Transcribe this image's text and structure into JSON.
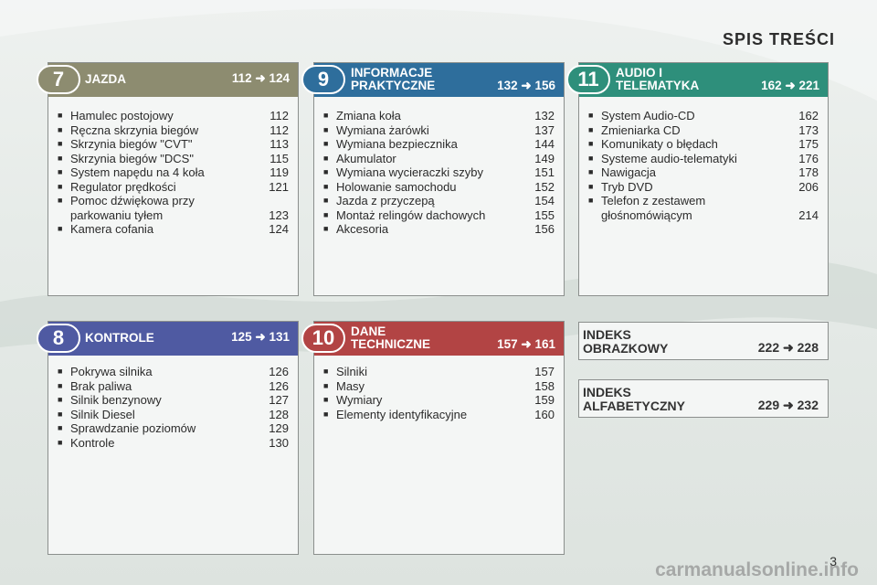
{
  "page_title": "SPIS TREŚCI",
  "colors": {
    "jazda": "#8d8c70",
    "kontrole": "#4f5aa2",
    "informacje": "#2e6e9c",
    "dane": "#b24444",
    "audio": "#2e8f7b"
  },
  "sections": {
    "jazda": {
      "number": "7",
      "title": "JAZDA",
      "pages": "112 ➜ 124",
      "items": [
        {
          "label": "Hamulec postojowy",
          "page": "112"
        },
        {
          "label": "Ręczna skrzynia biegów",
          "page": "112"
        },
        {
          "label": "Skrzynia biegów \"CVT\"",
          "page": "113"
        },
        {
          "label": "Skrzynia biegów \"DCS\"",
          "page": "115"
        },
        {
          "label": "System napędu na 4 koła",
          "page": "119"
        },
        {
          "label": "Regulator prędkości",
          "page": "121"
        },
        {
          "label": "Pomoc dźwiękowa przy parkowaniu tyłem",
          "page": "123"
        },
        {
          "label": "Kamera cofania",
          "page": "124"
        }
      ]
    },
    "kontrole": {
      "number": "8",
      "title": "KONTROLE",
      "pages": "125 ➜ 131",
      "items": [
        {
          "label": "Pokrywa silnika",
          "page": "126"
        },
        {
          "label": "Brak paliwa",
          "page": "126"
        },
        {
          "label": "Silnik benzynowy",
          "page": "127"
        },
        {
          "label": "Silnik Diesel",
          "page": "128"
        },
        {
          "label": "Sprawdzanie poziomów",
          "page": "129"
        },
        {
          "label": "Kontrole",
          "page": "130"
        }
      ]
    },
    "informacje": {
      "number": "9",
      "title_line1": "INFORMACJE",
      "title_line2": "PRAKTYCZNE",
      "pages": "132 ➜ 156",
      "items": [
        {
          "label": "Zmiana koła",
          "page": "132"
        },
        {
          "label": "Wymiana żarówki",
          "page": "137"
        },
        {
          "label": "Wymiana bezpiecznika",
          "page": "144"
        },
        {
          "label": "Akumulator",
          "page": "149"
        },
        {
          "label": "Wymiana wycieraczki szyby",
          "page": "151"
        },
        {
          "label": "Holowanie samochodu",
          "page": "152"
        },
        {
          "label": "Jazda z przyczepą",
          "page": "154"
        },
        {
          "label": "Montaż relingów dachowych",
          "page": "155"
        },
        {
          "label": "Akcesoria",
          "page": "156"
        }
      ]
    },
    "dane": {
      "number": "10",
      "title_line1": "DANE",
      "title_line2": "TECHNICZNE",
      "pages": "157 ➜ 161",
      "items": [
        {
          "label": "Silniki",
          "page": "157"
        },
        {
          "label": "Masy",
          "page": "158"
        },
        {
          "label": "Wymiary",
          "page": "159"
        },
        {
          "label": "Elementy identyfikacyjne",
          "page": "160"
        }
      ]
    },
    "audio": {
      "number": "11",
      "title_line1": "AUDIO I",
      "title_line2": "TELEMATYKA",
      "pages": "162 ➜ 221",
      "items": [
        {
          "label": "System Audio-CD",
          "page": "162"
        },
        {
          "label": "Zmieniarka CD",
          "page": "173"
        },
        {
          "label": "Komunikaty o błędach",
          "page": "175"
        },
        {
          "label": "Systeme audio-telematyki",
          "page": "176"
        },
        {
          "label": "Nawigacja",
          "page": "178"
        },
        {
          "label": "Tryb DVD",
          "page": "206"
        },
        {
          "label": "Telefon z zestawem głośnomówiącym",
          "page": "214"
        }
      ]
    }
  },
  "indexes": {
    "obrazkowy": {
      "line1": "INDEKS",
      "line2": "OBRAZKOWY",
      "pages": "222 ➜ 228"
    },
    "alfabetyczny": {
      "line1": "INDEKS",
      "line2": "ALFABETYCZNY",
      "pages": "229 ➜ 232"
    }
  },
  "page_number": "3",
  "watermark": "carmanualsonline.info"
}
